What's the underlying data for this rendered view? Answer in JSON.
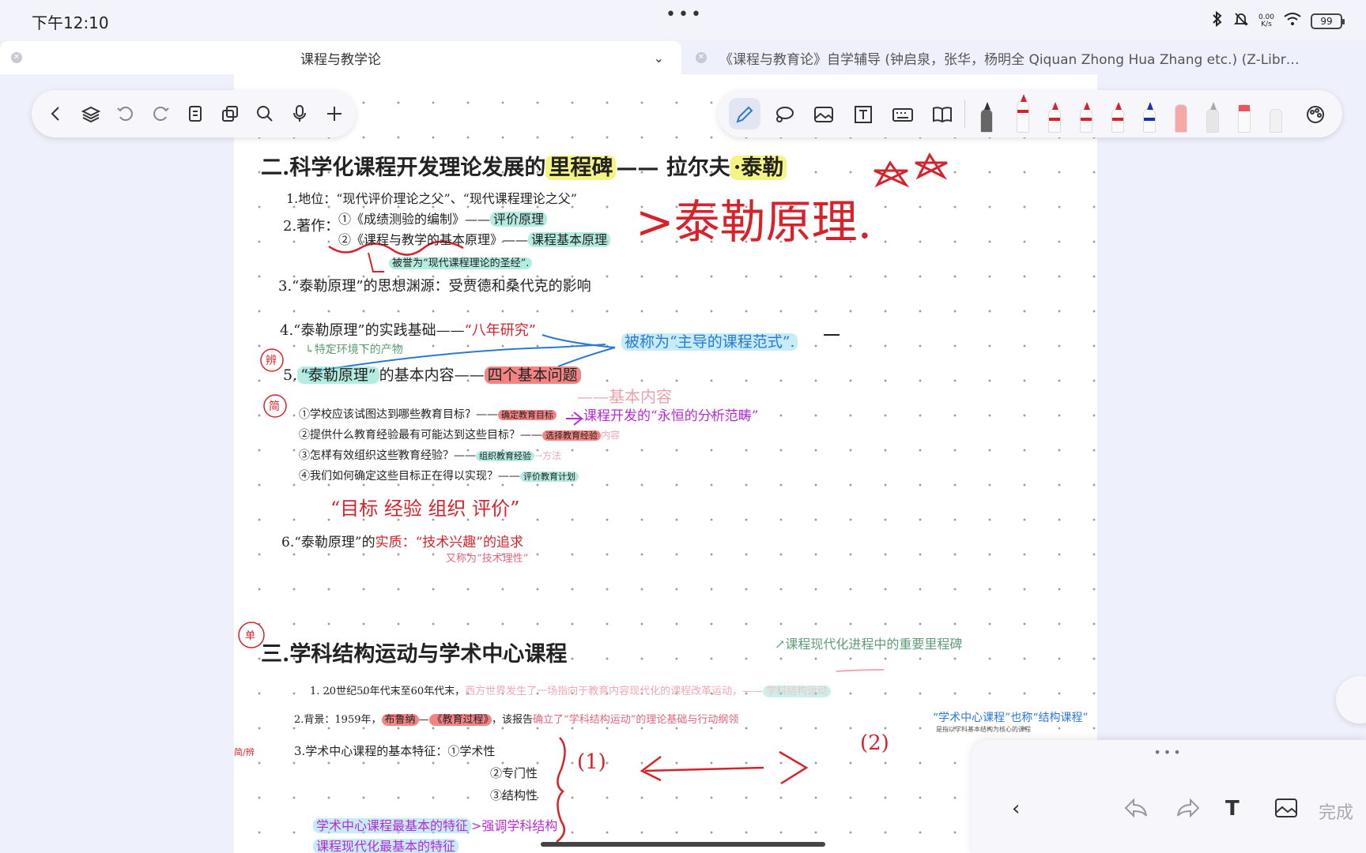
{
  "status": {
    "time": "下午12:10",
    "dots": "•••",
    "net_speed_value": "0.00",
    "net_speed_unit": "K/s",
    "battery": "99"
  },
  "tabs": [
    {
      "title": "课程与教学论"
    },
    {
      "title": "《课程与教育论》自学辅导 (钟启泉，张华，杨明全 Qiquan Zhong  Hua Zhang etc.) (Z-Libr…"
    }
  ],
  "toolbar_left": [
    "back-icon",
    "layers-icon",
    "undo-icon",
    "redo-icon",
    "page-icon",
    "copy-icon",
    "search-icon",
    "microphone-icon",
    "add-icon"
  ],
  "toolbar_right": [
    "pen-icon",
    "lasso-icon",
    "image-icon",
    "text-box-icon",
    "keyboard-icon",
    "book-icon",
    "color-palette-icon"
  ],
  "notes": {
    "heading2": "二.科学化课程开发理论发展的里程碑——拉尔夫·泰勒",
    "heading2_a": "二.科学化课程开发理论发展的",
    "heading2_b": "里程碑",
    "heading2_c": "—— 拉尔夫",
    "heading2_d": "·泰勒",
    "stars": "☆☆",
    "item1": "1.地位：“现代评价理论之父”、“现代课程理论之父”",
    "item2_label": "2.著作：",
    "item2_1": "①《成绩测验的编制》——",
    "item2_1_tag": "评价原理",
    "item2_2": "②《课程与教学的基本原理》——",
    "item2_2_tag": "课程基本原理",
    "item2_3": "被誉为“现代课程理论的圣经”.",
    "big_red": ">泰勒原理.",
    "item3": "3.“泰勒原理”的思想渊源：受贾德和桑代克的影响",
    "item4_a": "4.“泰勒原理”的实践基础——",
    "item4_tag": "“八年研究”",
    "item4_b": "↳特定环境下的产物",
    "mark_bian": "辨",
    "mark_jian": "简",
    "blue_note": "被称为“主导的课程范式”.",
    "item5_a": "5.",
    "item5_b": "“泰勒原理”",
    "item5_c": "的基本内容——",
    "item5_tag": "四个基本问题",
    "item5_pink": "——基本内容",
    "q1": "①学校应该试图达到哪些教育目标？——",
    "q1_tag": "确定教育目标",
    "q1_purple": "课程开发的“永恒的分析范畴”",
    "q2": "②提供什么教育经验最有可能达到这些目标？——",
    "q2_tag": "选择教育经验",
    "q2_extra": "内容",
    "q3": "③怎样有效组织这些教育经验？——",
    "q3_tag": "组织教育经验",
    "q3_extra": "→方法",
    "q4": "④我们如何确定这些目标正在得以实现？——",
    "q4_tag": "评价教育计划",
    "summary": "“目标 经验 组织 评价”",
    "item6_a": "6.“泰勒原理”的",
    "item6_b": "实质",
    "item6_c": "：“技术兴趣”的追求",
    "item6_d": "又称为“技术理性”",
    "mark_dan": "单",
    "heading3": "三.学科结构运动与学术中心课程",
    "side_green": "↗课程现代化进程中的重要里程碑",
    "s1_a": "1.  20世纪50年代末至60年代末，",
    "s1_b": "西方世界发生了一场指向于教育内容现代化的课程改革运动，——",
    "s1_tag": "学科结构运动",
    "s2_a": "2.背景：1959年，",
    "s2_tag1": "布鲁纳",
    "s2_dash": "—",
    "s2_tag2": "《教育过程》",
    "s2_b": "，该报告",
    "s2_c": "确立了“学科结构运动”的理论基础与行动纲领",
    "side_blue": "“学术中心课程”也称“结构课程”",
    "side_blue_small": "是指以学科基本结构为核心的课程",
    "mark_jianbian": "简/辨",
    "s3": "3.学术中心课程的基本特征：①学术性",
    "s3_2": "②专门性",
    "s3_3": "③结构性",
    "one": "(1)",
    "two": "(2)",
    "bottom1": "学术中心课程最基本的特征",
    "bottom1_b": ">强调学科结构",
    "bottom2": "课程现代化最基本的特征"
  },
  "float_panel": {
    "dots": "•••",
    "done": "完成"
  }
}
